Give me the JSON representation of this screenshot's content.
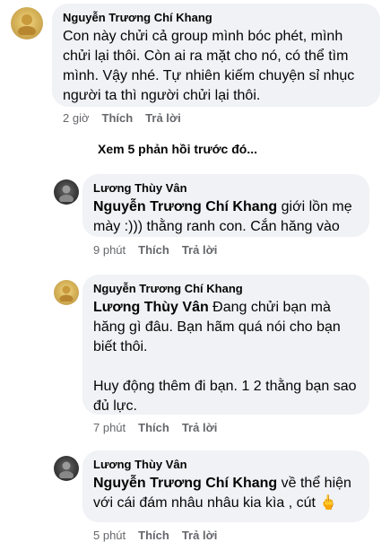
{
  "comments": [
    {
      "author": "Nguyễn Trương Chí Khang",
      "text": "Con này chửi cả group mình bóc phét, mình chửi lại thôi. Còn ai ra mặt cho nó, có thể tìm mình. Vậy nhé. Tự nhiên kiếm chuyện sỉ nhục người ta thì người chửi lại thôi.",
      "time": "2 giờ",
      "like": "Thích",
      "reply": "Trả lời"
    },
    {
      "author": "Lương Thùy Vân",
      "mention": "Nguyễn Trương Chí Khang",
      "text": " giới lồn mẹ mày :))) thằng ranh con. Cắn hăng vào",
      "time": "9 phút",
      "like": "Thích",
      "reply": "Trả lời"
    },
    {
      "author": "Nguyễn Trương Chí Khang",
      "mention": "Lương Thùy Vân",
      "text": " Đang chửi bạn mà hăng gì đâu. Bạn hãm quá nói cho bạn biết thôi.",
      "text2": "Huy động thêm đi bạn. 1 2 thằng bạn sao đủ lực.",
      "time": "7 phút",
      "like": "Thích",
      "reply": "Trả lời"
    },
    {
      "author": "Lương Thùy Vân",
      "mention": "Nguyễn Trương Chí Khang",
      "text": " về thể hiện với cái đám nhâu nhâu kia kìa , cút ",
      "emoji": "🖕",
      "time": "5 phút",
      "like": "Thích",
      "reply": "Trả lời"
    }
  ],
  "view_more": "Xem 5 phản hồi trước đó..."
}
